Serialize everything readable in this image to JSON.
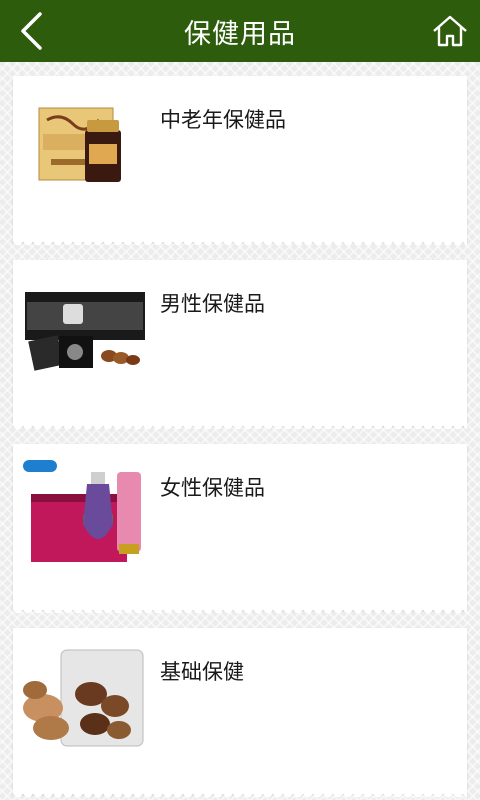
{
  "header": {
    "title": "保健用品",
    "back_icon": "back-chevron-icon",
    "home_icon": "home-icon",
    "background": "#2e5c0d"
  },
  "categories": [
    {
      "label": "中老年保健品",
      "thumbnail": "elderly-health-product-box"
    },
    {
      "label": "男性保健品",
      "thumbnail": "male-health-product-box"
    },
    {
      "label": "女性保健品",
      "thumbnail": "female-health-product-box"
    },
    {
      "label": "基础保健",
      "thumbnail": "mushroom-bag"
    }
  ]
}
